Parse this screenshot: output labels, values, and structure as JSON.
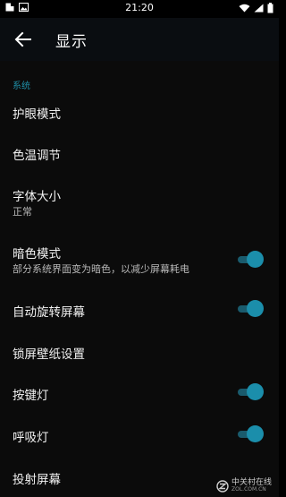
{
  "status_bar": {
    "time": "21:20",
    "left_icons": [
      "notification-square-icon",
      "image-icon"
    ],
    "right_icons": [
      "wifi-icon",
      "signal-icon",
      "battery-icon"
    ]
  },
  "app_bar": {
    "back_icon": "arrow-left-icon",
    "title": "显示"
  },
  "section": {
    "title": "系统"
  },
  "settings": [
    {
      "label": "护眼模式",
      "sublabel": "",
      "toggle": null
    },
    {
      "label": "色温调节",
      "sublabel": "",
      "toggle": null
    },
    {
      "label": "字体大小",
      "sublabel": "正常",
      "toggle": null
    },
    {
      "label": "暗色模式",
      "sublabel": "部分系统界面变为暗色，以减少屏幕耗电",
      "toggle": true
    },
    {
      "label": "自动旋转屏幕",
      "sublabel": "",
      "toggle": true
    },
    {
      "label": "锁屏壁纸设置",
      "sublabel": "",
      "toggle": null
    },
    {
      "label": "按键灯",
      "sublabel": "",
      "toggle": true
    },
    {
      "label": "呼吸灯",
      "sublabel": "",
      "toggle": true
    },
    {
      "label": "投射屏幕",
      "sublabel": "",
      "toggle": null
    }
  ],
  "watermark": {
    "cn": "中关村在线",
    "en": "ZOL.COM.CN"
  },
  "colors": {
    "accent": "#1b8eab",
    "accent_track": "#1a5b6d",
    "section_title": "#1f8fa8",
    "background": "#0b0b0b",
    "app_bar": "#0a0d11"
  }
}
